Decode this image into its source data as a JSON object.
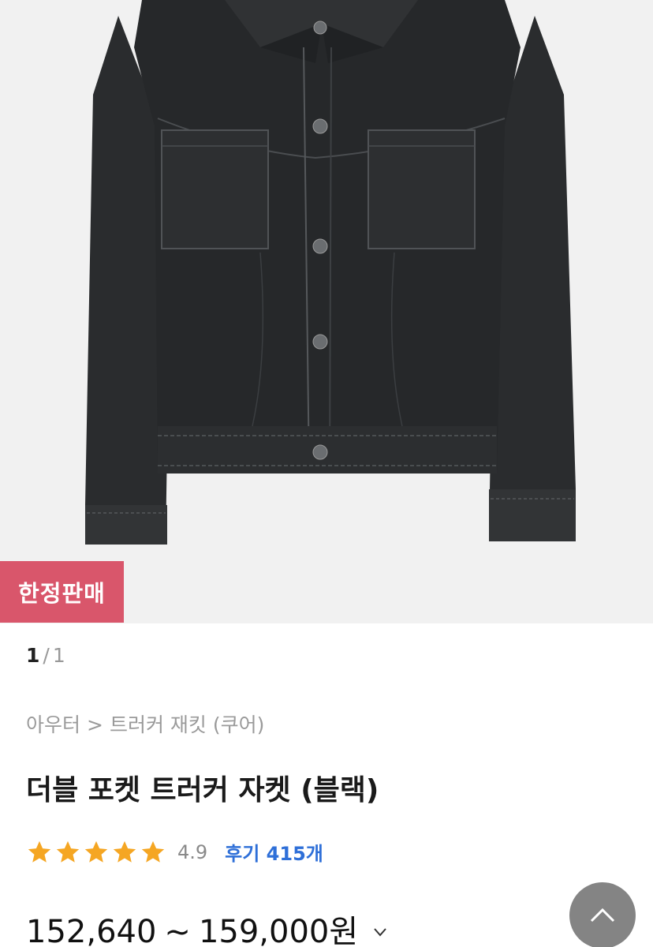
{
  "product": {
    "badge": "한정판매",
    "image_alt": "더블 포켓 트러커 자켓 (블랙)",
    "pager": {
      "current": "1",
      "separator": "/",
      "total": "1"
    },
    "breadcrumb": {
      "category": "아우터",
      "separator": ">",
      "subcategory": "트러커 재킷 (쿠어)"
    },
    "title": "더블 포켓 트러커 자켓 (블랙)",
    "rating": {
      "score": "4.9",
      "stars": 5,
      "review_label": "후기 415개"
    },
    "price": {
      "min": "152,640",
      "tilde": "~",
      "max": "159,000원"
    }
  },
  "colors": {
    "badge_bg": "#d9566b",
    "star": "#f5a623",
    "review_link": "#2e6fd8",
    "jacket": "#2b2d2f",
    "image_bg": "#f1f1f1"
  },
  "icons": {
    "rating_star": "star-icon",
    "price_toggle": "chevron-down-icon",
    "scroll_top": "chevron-up-icon"
  }
}
